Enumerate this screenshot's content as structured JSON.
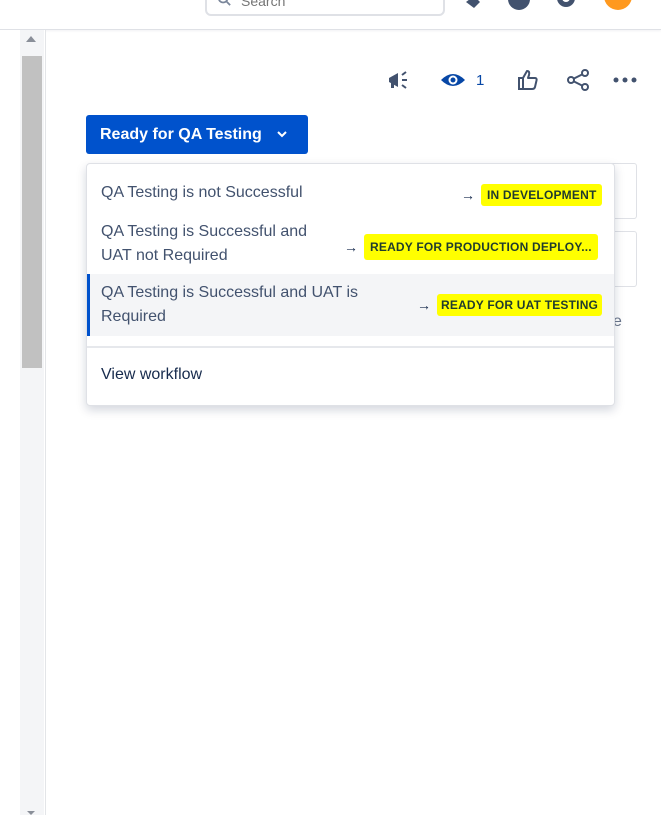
{
  "topbar": {
    "search_placeholder": "Search"
  },
  "toolbar": {
    "watch_count": "1"
  },
  "status_button": {
    "label": "Ready for QA Testing"
  },
  "transitions": [
    {
      "label": "QA Testing is not Successful",
      "target": "IN DEVELOPMENT"
    },
    {
      "label_line1": "QA Testing is Successful and",
      "label_line2": "UAT not Required",
      "target": "READY FOR PRODUCTION DEPLOY..."
    },
    {
      "label_line1": "QA Testing is Successful and UAT is",
      "label_line2": "Required",
      "target": "READY FOR UAT TESTING"
    }
  ],
  "arrow_glyph": "→",
  "view_workflow": "View workflow",
  "background": {
    "trailing_letter": "e"
  },
  "colors": {
    "primary": "#0052cc",
    "highlight": "#ffff00",
    "text": "#42526e"
  }
}
